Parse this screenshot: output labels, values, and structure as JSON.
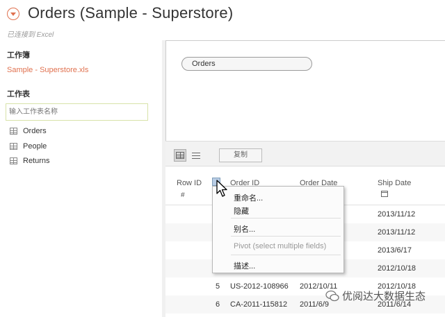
{
  "header": {
    "title": "Orders (Sample - Superstore)",
    "subtitle": "已连接到 Excel"
  },
  "sidebar": {
    "workbook_label": "工作簿",
    "workbook_file": "Sample - Superstore.xls",
    "sheets_label": "工作表",
    "search_placeholder": "输入工作表名称",
    "sheets": [
      {
        "label": "Orders"
      },
      {
        "label": "People"
      },
      {
        "label": "Returns"
      }
    ]
  },
  "canvas": {
    "table_pill": "Orders"
  },
  "toolbar": {
    "copy_label": "复制"
  },
  "grid": {
    "columns": [
      {
        "name": "Row ID",
        "type_icon": "#"
      },
      {
        "name": "Order ID",
        "type_icon": ""
      },
      {
        "name": "Order Date",
        "type_icon": ""
      },
      {
        "name": "Ship Date",
        "type_icon": "calendar-icon"
      }
    ],
    "rows": [
      {
        "row_id": "",
        "order_id": "",
        "order_date": "",
        "ship_date": "2013/11/12"
      },
      {
        "row_id": "",
        "order_id": "",
        "order_date": "",
        "ship_date": "2013/11/12"
      },
      {
        "row_id": "",
        "order_id": "",
        "order_date": "",
        "ship_date": "2013/6/17"
      },
      {
        "row_id": "",
        "order_id": "",
        "order_date": "",
        "ship_date": "2012/10/18"
      },
      {
        "row_id": "5",
        "order_id": "US-2012-108966",
        "order_date": "2012/10/11",
        "ship_date": "2012/10/18"
      },
      {
        "row_id": "6",
        "order_id": "CA-2011-115812",
        "order_date": "2011/6/9",
        "ship_date": "2011/6/14"
      }
    ]
  },
  "context_menu": {
    "items": [
      {
        "label": "重命名...",
        "disabled": false
      },
      {
        "label": "隐藏",
        "disabled": false
      },
      {
        "label": "别名...",
        "disabled": false
      },
      {
        "label": "Pivot (select multiple fields)",
        "disabled": true
      },
      {
        "label": "描述...",
        "disabled": false
      }
    ]
  },
  "watermark": {
    "text": "优阅达大数据生态"
  },
  "colors": {
    "accent": "#e0714f",
    "selection": "#b9cde5"
  }
}
